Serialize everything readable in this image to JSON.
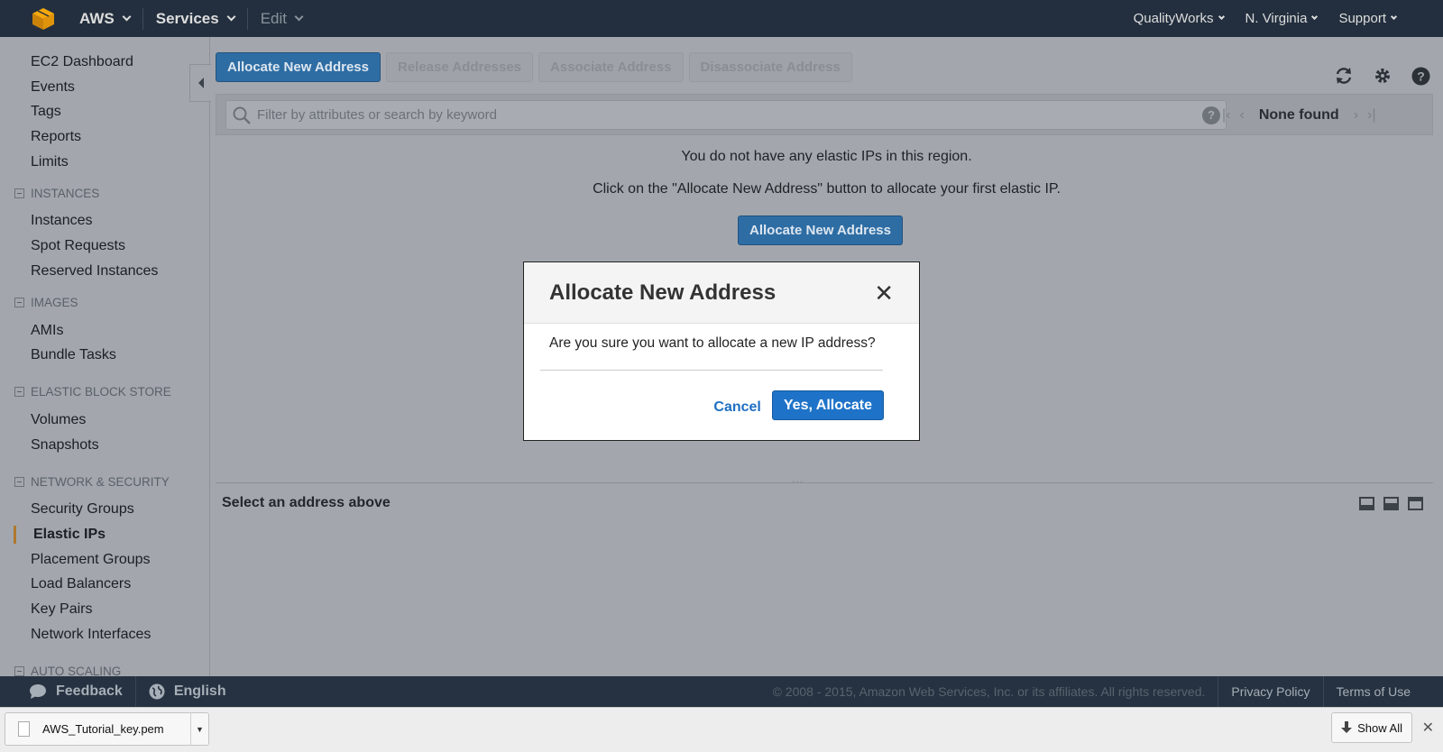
{
  "topbar": {
    "brand": "AWS",
    "services": "Services",
    "edit": "Edit",
    "account": "QualityWorks",
    "region": "N. Virginia",
    "support": "Support"
  },
  "sidebar": {
    "top_items": [
      "EC2 Dashboard",
      "Events",
      "Tags",
      "Reports",
      "Limits"
    ],
    "sections": [
      {
        "title": "INSTANCES",
        "items": [
          "Instances",
          "Spot Requests",
          "Reserved Instances"
        ]
      },
      {
        "title": "IMAGES",
        "items": [
          "AMIs",
          "Bundle Tasks"
        ]
      },
      {
        "title": "ELASTIC BLOCK STORE",
        "items": [
          "Volumes",
          "Snapshots"
        ]
      },
      {
        "title": "NETWORK & SECURITY",
        "items": [
          "Security Groups",
          "Elastic IPs",
          "Placement Groups",
          "Load Balancers",
          "Key Pairs",
          "Network Interfaces"
        ]
      },
      {
        "title": "AUTO SCALING",
        "items": []
      }
    ],
    "active_item": "Elastic IPs"
  },
  "toolbar": {
    "allocate": "Allocate New Address",
    "release": "Release Addresses",
    "associate": "Associate Address",
    "disassociate": "Disassociate Address"
  },
  "search": {
    "placeholder": "Filter by attributes or search by keyword",
    "help": "?",
    "pager_status": "None found"
  },
  "empty_state": {
    "line1": "You do not have any elastic IPs in this region.",
    "line2": "Click on the \"Allocate New Address\" button to allocate your first elastic IP.",
    "button": "Allocate New Address"
  },
  "detail": {
    "title": "Select an address above"
  },
  "modal": {
    "title": "Allocate New Address",
    "message": "Are you sure you want to allocate a new IP address?",
    "cancel": "Cancel",
    "confirm": "Yes, Allocate"
  },
  "footer": {
    "feedback": "Feedback",
    "language": "English",
    "copyright": "© 2008 - 2015, Amazon Web Services, Inc. or its affiliates. All rights reserved.",
    "privacy": "Privacy Policy",
    "terms": "Terms of Use"
  },
  "downloads": {
    "file": "AWS_Tutorial_key.pem",
    "show_all": "Show All"
  },
  "colors": {
    "topbar": "#232f3e",
    "primary_button": "#2e6da4",
    "modal_confirm": "#1e73c8",
    "active_marker": "#b0782f"
  }
}
